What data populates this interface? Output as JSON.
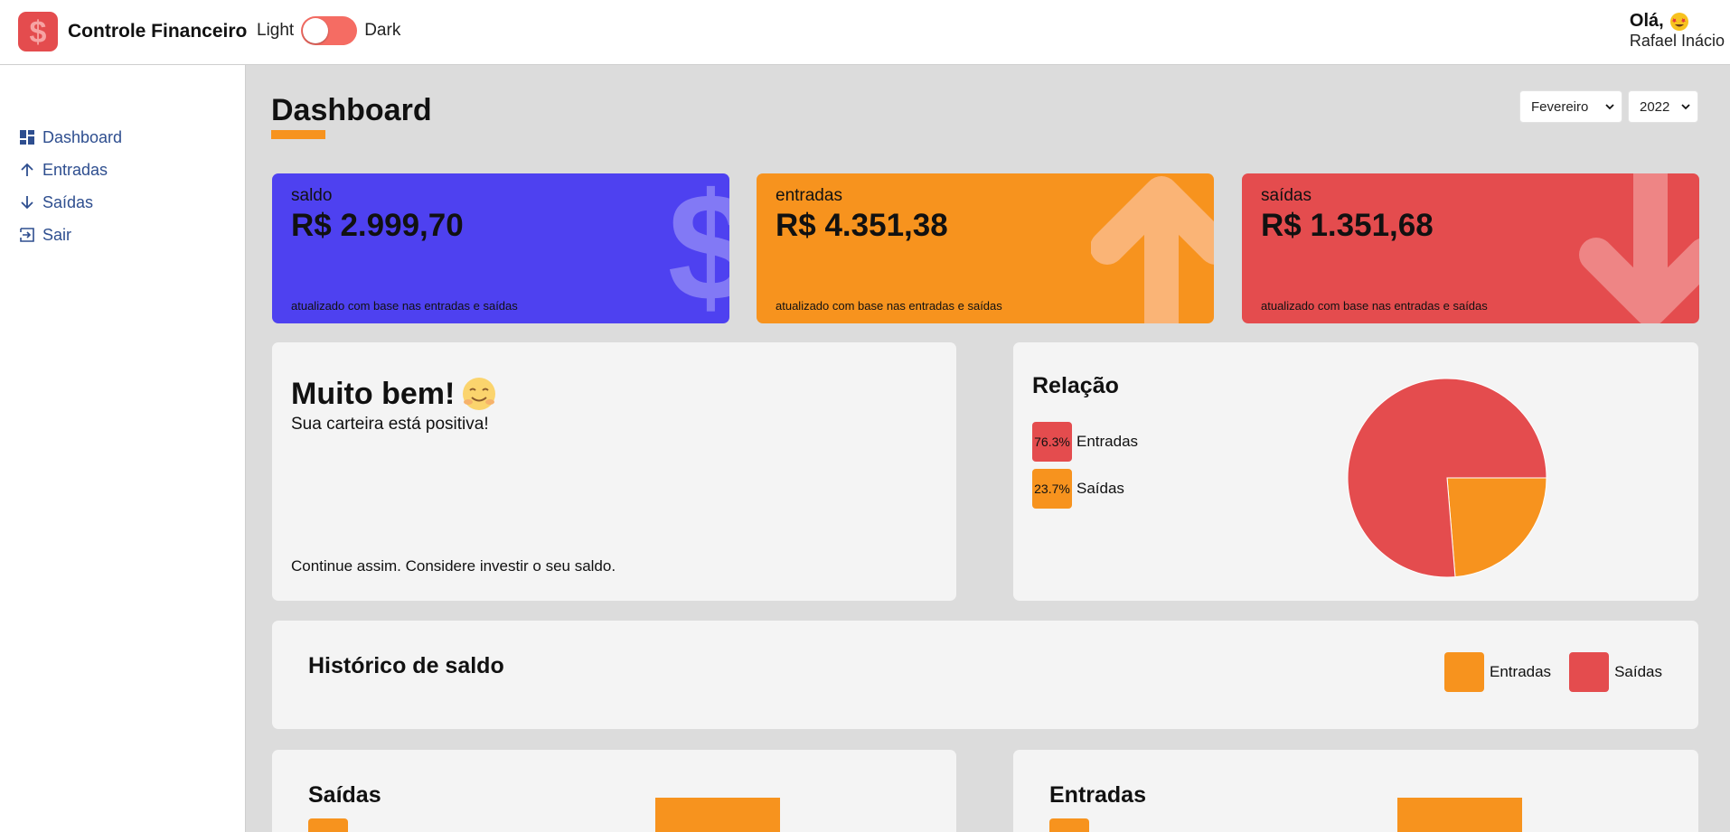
{
  "app": {
    "title": "Controle Financeiro"
  },
  "theme": {
    "light_label": "Light",
    "dark_label": "Dark",
    "mode": "light"
  },
  "user": {
    "greeting": "Olá,",
    "name": "Rafael Inácio"
  },
  "sidebar": {
    "items": [
      {
        "label": "Dashboard",
        "icon": "dashboard-icon"
      },
      {
        "label": "Entradas",
        "icon": "arrow-up-icon"
      },
      {
        "label": "Saídas",
        "icon": "arrow-down-icon"
      },
      {
        "label": "Sair",
        "icon": "exit-icon"
      }
    ]
  },
  "page": {
    "title": "Dashboard"
  },
  "filters": {
    "month": "Fevereiro",
    "year": "2022"
  },
  "cards": {
    "saldo": {
      "title": "saldo",
      "value": "R$ 2.999,70",
      "footer": "atualizado com base nas entradas e saídas",
      "color": "#4E41F0"
    },
    "entradas": {
      "title": "entradas",
      "value": "R$ 4.351,38",
      "footer": "atualizado com base nas entradas e saídas",
      "color": "#F7931E"
    },
    "saidas": {
      "title": "saídas",
      "value": "R$ 1.351,68",
      "footer": "atualizado com base nas entradas e saídas",
      "color": "#E44C4E"
    }
  },
  "message": {
    "title": "Muito bem!",
    "description": "Sua carteira está positiva!",
    "footer": "Continue assim. Considere investir o seu saldo."
  },
  "relacao": {
    "title": "Relação",
    "items": [
      {
        "name": "Entradas",
        "percent_label": "76.3%",
        "percent": 76.3,
        "color": "#E44C4E"
      },
      {
        "name": "Saídas",
        "percent_label": "23.7%",
        "percent": 23.7,
        "color": "#F7931E"
      }
    ]
  },
  "historico": {
    "title": "Histórico de saldo",
    "legend": [
      {
        "name": "Entradas",
        "color": "#F7931E"
      },
      {
        "name": "Saídas",
        "color": "#E44C4E"
      }
    ]
  },
  "bottom": {
    "saidas_title": "Saídas",
    "entradas_title": "Entradas"
  }
}
